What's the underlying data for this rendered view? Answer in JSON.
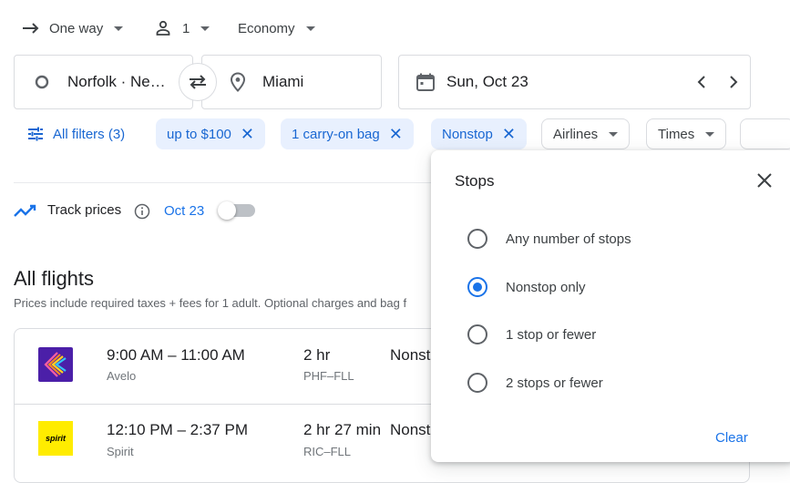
{
  "trip": {
    "type": "One way",
    "passengers": "1",
    "cabin": "Economy"
  },
  "search": {
    "origin": "Norfolk · Ne…",
    "destination": "Miami",
    "date": "Sun, Oct 23"
  },
  "filters": {
    "all_label": "All filters (3)",
    "active": [
      "up to $100",
      "1 carry-on bag",
      "Nonstop"
    ],
    "dropdowns": [
      "Airlines",
      "Times"
    ]
  },
  "track": {
    "label": "Track prices",
    "date": "Oct 23"
  },
  "results": {
    "heading": "All flights",
    "note": "Prices include required taxes + fees for 1 adult. Optional charges and bag f",
    "flights": [
      {
        "times": "9:00 AM – 11:00 AM",
        "airline": "Avelo",
        "duration": "2 hr",
        "route": "PHF–FLL",
        "stops": "Nonst"
      },
      {
        "times": "12:10 PM – 2:37 PM",
        "airline": "Spirit",
        "duration": "2 hr 27 min",
        "route": "RIC–FLL",
        "stops": "Nonst",
        "logo_text": "spirit"
      }
    ]
  },
  "stops_popup": {
    "title": "Stops",
    "options": [
      "Any number of stops",
      "Nonstop only",
      "1 stop or fewer",
      "2 stops or fewer"
    ],
    "selected_index": 1,
    "clear_label": "Clear"
  },
  "colors": {
    "accent": "#1a73e8",
    "chip_bg": "#e8f0fe",
    "avelo_purple": "#4b1fa8",
    "spirit_yellow": "#ffec00"
  }
}
